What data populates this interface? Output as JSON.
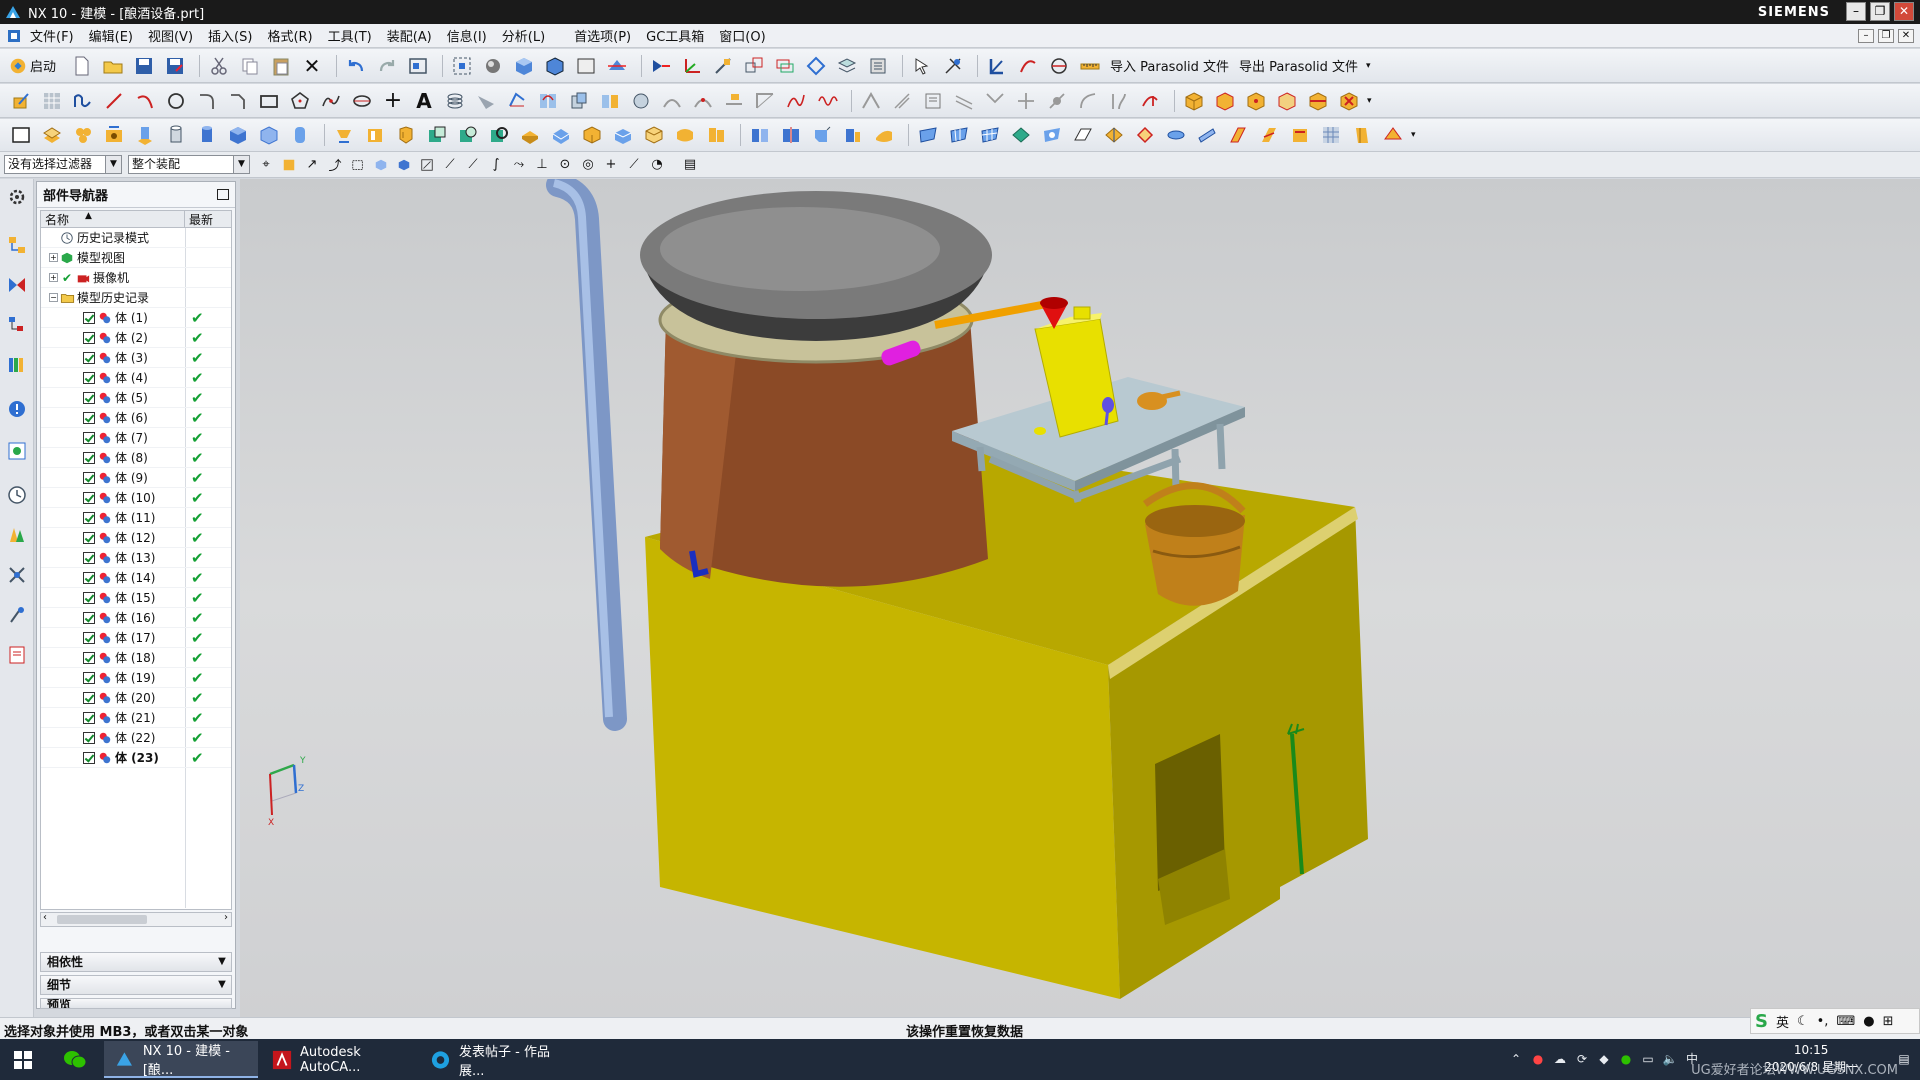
{
  "window": {
    "title": "NX 10 - 建模 - [酿酒设备.prt]",
    "brand": "SIEMENS",
    "controls": [
      "–",
      "❐",
      "✕"
    ]
  },
  "menu": [
    "文件(F)",
    "编辑(E)",
    "视图(V)",
    "插入(S)",
    "格式(R)",
    "工具(T)",
    "装配(A)",
    "信息(I)",
    "分析(L)",
    "首选项(P)",
    "GC工具箱",
    "窗口(O)"
  ],
  "toolbar": {
    "start_label": "启动",
    "import_label": "导入 Parasolid 文件",
    "export_label": "导出 Parasolid 文件"
  },
  "filters": {
    "selection_filter": "没有选择过滤器",
    "scope": "整个装配"
  },
  "navigator": {
    "title": "部件导航器",
    "col_name": "名称",
    "col_latest": "最新",
    "history_mode": "历史记录模式",
    "model_views": "模型视图",
    "cameras": "摄像机",
    "model_history": "模型历史记录",
    "bodies": [
      "体 (1)",
      "体 (2)",
      "体 (3)",
      "体 (4)",
      "体 (5)",
      "体 (6)",
      "体 (7)",
      "体 (8)",
      "体 (9)",
      "体 (10)",
      "体 (11)",
      "体 (12)",
      "体 (13)",
      "体 (14)",
      "体 (15)",
      "体 (16)",
      "体 (17)",
      "体 (18)",
      "体 (19)",
      "体 (20)",
      "体 (21)",
      "体 (22)",
      "体 (23)"
    ],
    "sections": [
      "相依性",
      "细节",
      "预览"
    ]
  },
  "triad": {
    "x": "X",
    "y": "Y",
    "z": "Z"
  },
  "status": {
    "left": "选择对象并使用 MB3，或者双击某一对象",
    "right": "该操作重置恢复数据"
  },
  "taskbar": {
    "tasks": [
      "NX 10 - 建模 - [酿...",
      "Autodesk AutoCA...",
      "发表帖子 - 作品展..."
    ],
    "time": "10:15",
    "date": "2020/6/8 星期一",
    "ime_label": "英",
    "watermark": "UG爱好者论坛WWW.UGSNX.COM"
  },
  "colors": {
    "base": "#c6b500",
    "tank": "#8b4a26",
    "pipe": "#8ea8d6",
    "table": "#b8c9d1",
    "jug": "#e8e000",
    "bucket": "#c0801a"
  }
}
